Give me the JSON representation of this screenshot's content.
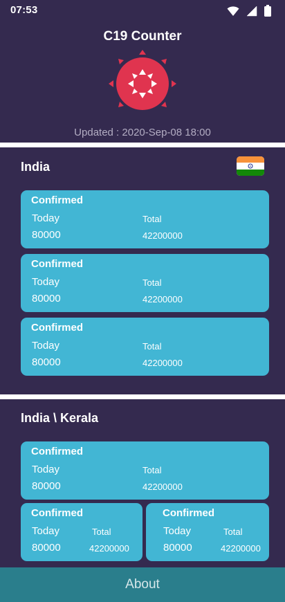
{
  "status_bar": {
    "time": "07:53",
    "icons": [
      "wifi-icon",
      "signal-icon",
      "battery-icon"
    ]
  },
  "header": {
    "title": "C19 Counter",
    "logo": "virus-icon",
    "updated": "Updated : 2020-Sep-08 18:00"
  },
  "country_section": {
    "title": "India",
    "flag": "india-flag-icon",
    "cards": [
      {
        "label": "Confirmed",
        "today_label": "Today",
        "today_value": "80000",
        "total_label": "Total",
        "total_value": "42200000"
      },
      {
        "label": "Confirmed",
        "today_label": "Today",
        "today_value": "80000",
        "total_label": "Total",
        "total_value": "42200000"
      },
      {
        "label": "Confirmed",
        "today_label": "Today",
        "today_value": "80000",
        "total_label": "Total",
        "total_value": "42200000"
      }
    ]
  },
  "state_section": {
    "title": "India \\ Kerala",
    "cards": [
      {
        "label": "Confirmed",
        "today_label": "Today",
        "today_value": "80000",
        "total_label": "Total",
        "total_value": "42200000"
      },
      {
        "label": "Confirmed",
        "today_label": "Today",
        "today_value": "80000",
        "total_label": "Total",
        "total_value": "42200000"
      },
      {
        "label": "Confirmed",
        "today_label": "Today",
        "today_value": "80000",
        "total_label": "Total",
        "total_value": "42200000"
      }
    ]
  },
  "footer": {
    "about_label": "About"
  },
  "colors": {
    "background": "#342a4f",
    "card": "#42b6d4",
    "virus": "#e0344f",
    "footer": "#2a7e8c"
  }
}
